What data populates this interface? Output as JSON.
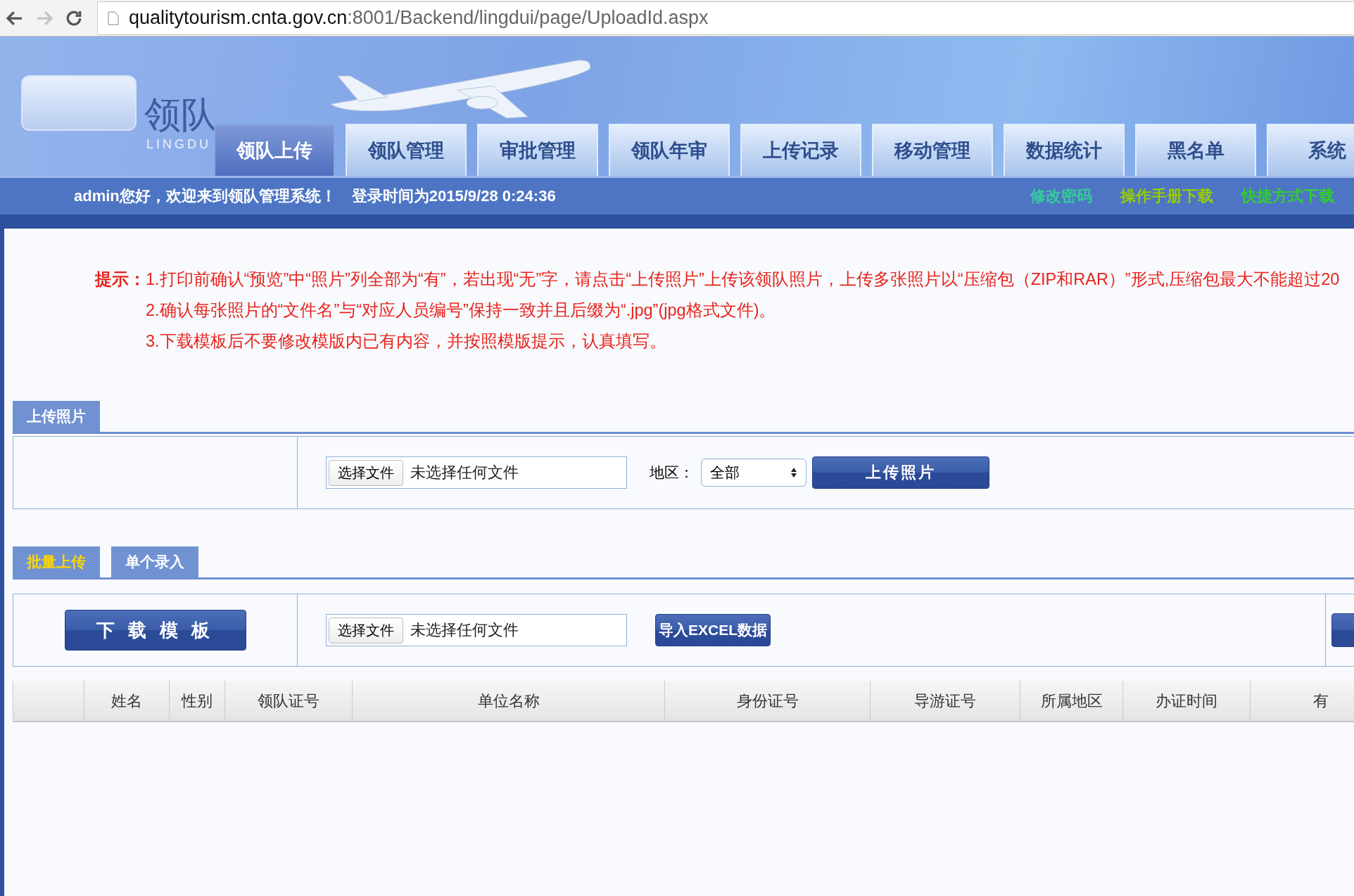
{
  "browser": {
    "nav_buttons": [
      {
        "kind": "back",
        "disabled": false
      },
      {
        "kind": "forward",
        "disabled": true
      },
      {
        "kind": "reload",
        "disabled": false
      }
    ],
    "url": {
      "host": "qualitytourism.cnta.gov.cn",
      "rest": ":8001/Backend/lingdui/page/UploadId.aspx"
    }
  },
  "header": {
    "logo_title": "领队",
    "logo_subtitle": "LINGDU",
    "nav_tabs": [
      {
        "label": "领队上传",
        "selected": true
      },
      {
        "label": "领队管理",
        "selected": false
      },
      {
        "label": "审批管理",
        "selected": false
      },
      {
        "label": "领队年审",
        "selected": false
      },
      {
        "label": "上传记录",
        "selected": false
      },
      {
        "label": "移动管理",
        "selected": false
      },
      {
        "label": "数据统计",
        "selected": false
      },
      {
        "label": "黑名单",
        "selected": false
      },
      {
        "label": "系统",
        "selected": false
      }
    ]
  },
  "welcome_bar": {
    "greeting": "admin您好，欢迎来到领队管理系统！",
    "login_time": "登录时间为2015/9/28 0:24:36",
    "links": [
      {
        "label": "修改密码",
        "color": "#33cc99"
      },
      {
        "label": "操作手册下载",
        "color": "#99cc00"
      },
      {
        "label": "快捷方式下载",
        "color": "#33cc33"
      }
    ]
  },
  "notice": {
    "label": "提示：",
    "lines": [
      "1.打印前确认“预览”中“照片”列全部为“有”，若出现“无”字，请点击“上传照片”上传该领队照片，上传多张照片以“压缩包（ZIP和RAR）”形式,压缩包最大不能超过20",
      "2.确认每张照片的“文件名”与“对应人员编号”保持一致并且后缀为“.jpg”(jpg格式文件)。",
      "3.下载模板后不要修改模版内已有内容，并按照模版提示，认真填写。"
    ]
  },
  "photo_upload": {
    "tab": "上传照片",
    "file_button": "选择文件",
    "file_status": "未选择任何文件",
    "region_label": "地区：",
    "region_select": "全部",
    "upload_button": "上传照片"
  },
  "batch": {
    "tabs": [
      {
        "label": "批量上传",
        "selected": true
      },
      {
        "label": "单个录入",
        "selected": false
      }
    ],
    "download_button": "下 载 模 板",
    "file_button": "选择文件",
    "file_status": "未选择任何文件",
    "import_button": "导入EXCEL数据"
  },
  "table": {
    "columns": [
      "姓名",
      "性别",
      "领队证号",
      "单位名称",
      "身份证号",
      "导游证号",
      "所属地区",
      "办证时间",
      "有"
    ]
  }
}
